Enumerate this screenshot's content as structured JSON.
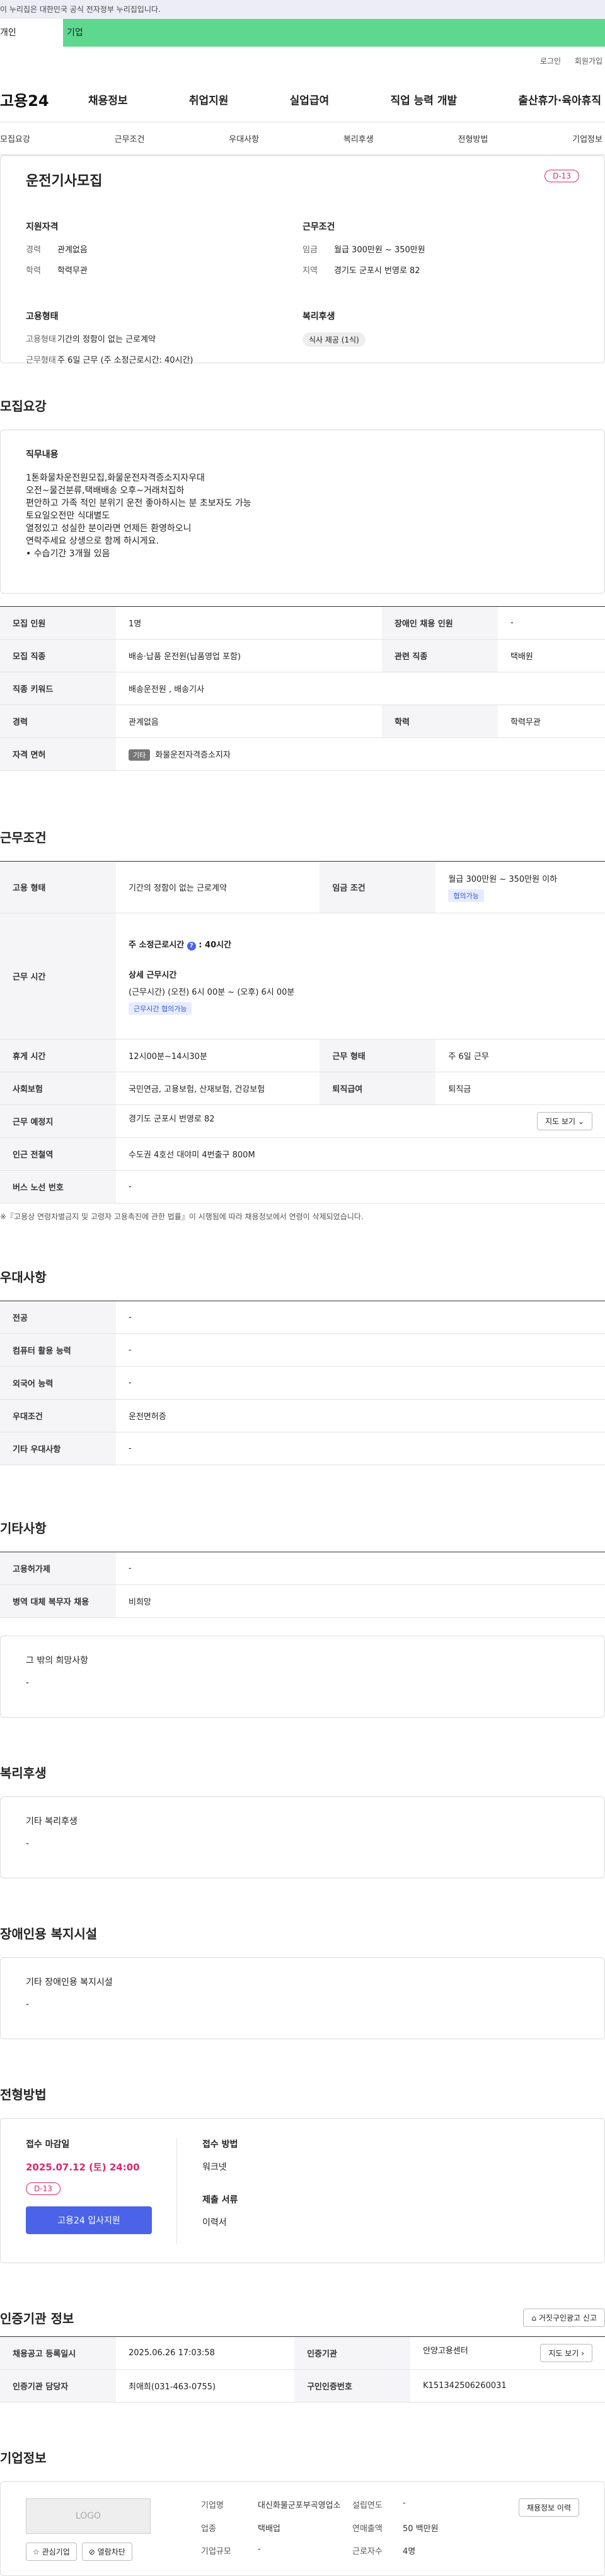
{
  "gov": "이 누리집은 대한민국 공식 전자정부 누리집입니다.",
  "tabs": {
    "person": "개인",
    "company": "기업"
  },
  "util": {
    "login": "로그인",
    "join": "회원가입"
  },
  "logo": "고용24",
  "gnb": [
    "채용정보",
    "취업지원",
    "실업급여",
    "직업 능력 개발",
    "출산휴가·육아휴직"
  ],
  "anchors": [
    "모집요강",
    "근무조건",
    "우대사항",
    "복리후생",
    "전형방법",
    "기업정보"
  ],
  "summary": {
    "title": "운전기사모집",
    "dday": "D-13",
    "qual_h": "지원자격",
    "career_k": "경력",
    "career_v": "관계없음",
    "edu_k": "학력",
    "edu_v": "학력무관",
    "cond_h": "근무조건",
    "pay_k": "임금",
    "pay_v": "월급 300만원 ~ 350만원",
    "loc_k": "지역",
    "loc_v": "경기도 군포시 번영로 82",
    "emp_h": "고용형태",
    "emptype_k": "고용형태",
    "emptype_v": "기간의 정함이 없는 근로계약",
    "worktype_k": "근무형태",
    "worktype_v": "주 6일 근무 (주 소정근로시간: 40시간)",
    "wel_h": "복리후생",
    "wel_chip": "식사 제공 (1식)"
  },
  "recruit": {
    "title": "모집요강",
    "box_h": "직무내용",
    "desc": "1톤화물차운전원모집,화물운전자격증소지자우대\n오전~물건분류,택배배송 오후~거래처집하\n편안하고 가족 적인 분위기 운전 좋아하시는 분 초보자도 가능\n토요일오전만 식대별도\n열정있고 성실한 분이라면 언제든 환영하오니\n연락주세요 상생으로 함께 하시게요.\n• 수습기간 3개월 있음",
    "rows": [
      {
        "k1": "모집 인원",
        "v1": "1명",
        "k2": "장애인 채용 인원",
        "v2": "-"
      },
      {
        "k1": "모집 직종",
        "v1": "배송·납품 운전원(납품영업 포함)",
        "k2": "관련 직종",
        "v2": "택배원"
      },
      {
        "k1": "직종 키워드",
        "v1": "배송운전원 , 배송기사"
      },
      {
        "k1": "경력",
        "v1": "관계없음",
        "k2": "학력",
        "v2": "학력무관"
      },
      {
        "k1": "자격 면허",
        "badge": "기타",
        "v1": "화물운전자격증소지자"
      }
    ]
  },
  "work": {
    "title": "근무조건",
    "emp_k": "고용 형태",
    "emp_v": "기간의 정함이 없는 근로계약",
    "pay_k": "임금 조건",
    "pay_v": "월급 300만원 ~ 350만원 이하",
    "pay_chip": "협의가능",
    "hours_k": "근무 시간",
    "hours_l1": "주 소정근로시간",
    "hours_l1v": "40시간",
    "hours_h": "상세 근무시간",
    "hours_v": "(근무시간) (오전) 6시 00분 ~ (오후) 6시 00분",
    "hours_chip": "근무시간 협의가능",
    "rest_k": "휴게 시간",
    "rest_v": "12시00분~14시30분",
    "form_k": "근무 형태",
    "form_v": "주 6일 근무",
    "ins_k": "사회보험",
    "ins_v": "국민연금, 고용보험, 산재보험, 건강보험",
    "ret_k": "퇴직급여",
    "ret_v": "퇴직금",
    "place_k": "근무 예정지",
    "place_v": "경기도 군포시 번영로 82",
    "map_btn": "지도 보기",
    "station_k": "인근 전철역",
    "station_v": "수도권 4호선 대야미 4번출구 800M",
    "bus_k": "버스 노선 번호",
    "bus_v": "-",
    "note": "※『고용상 연령차별금지 및 고령자 고용촉진에 관한 법률』이 시행됨에 따라 채용정보에서 연령이 삭제되었습니다."
  },
  "pref": {
    "title": "우대사항",
    "rows": [
      {
        "k": "전공",
        "v": "-"
      },
      {
        "k": "컴퓨터 활용 능력",
        "v": "-"
      },
      {
        "k": "외국어 능력",
        "v": "-"
      },
      {
        "k": "우대조건",
        "v": "운전면허증"
      },
      {
        "k": "기타 우대사항",
        "v": "-"
      }
    ]
  },
  "etc": {
    "title": "기타사항",
    "rows": [
      {
        "k": "고용허가제",
        "v": "-"
      },
      {
        "k": "병역 대체 복무자 채용",
        "v": "비희망"
      }
    ],
    "box_h": "그 밖의 희망사항",
    "box_v": "-"
  },
  "welfare": {
    "title": "복리후생",
    "box_h": "기타 복리후생",
    "box_v": "-"
  },
  "disab": {
    "title": "장애인용 복지시설",
    "box_h": "기타 장애인용 복지시설",
    "box_v": "-"
  },
  "apply": {
    "title": "전형방법",
    "deadline_h": "접수 마감일",
    "deadline_v": "2025.07.12 (토) 24:00",
    "dday": "D-13",
    "btn": "고용24 입사지원",
    "method_h": "접수 방법",
    "method_v": "워크넷",
    "docs_h": "제출 서류",
    "docs_v": "이력서"
  },
  "agency": {
    "title": "인증기관 정보",
    "report_btn": "거짓구인광고 신고",
    "r1": {
      "k1": "채용공고 등록일시",
      "v1": "2025.06.26 17:03:58",
      "k2": "인증기관",
      "v2": "안양고용센터",
      "btn": "지도 보기"
    },
    "r2": {
      "k1": "인증기관 담당자",
      "v1": "최애희(031-463-0755)",
      "k2": "구인인증번호",
      "v2": "K151342506260031"
    }
  },
  "corp": {
    "title": "기업정보",
    "logo": "LOGO",
    "fav_btn": "관심기업",
    "block_btn": "열람차단",
    "list_btn": "채용정보 이력",
    "name_k": "기업명",
    "name_v": "대신화물군포부곡영업소",
    "ind_k": "업종",
    "ind_v": "택배업",
    "size_k": "기업규모",
    "size_v": "-",
    "year_k": "설립연도",
    "year_v": "-",
    "sales_k": "연매출액",
    "sales_v": "50 백만원",
    "emp_k": "근로자수",
    "emp_v": "4명"
  }
}
